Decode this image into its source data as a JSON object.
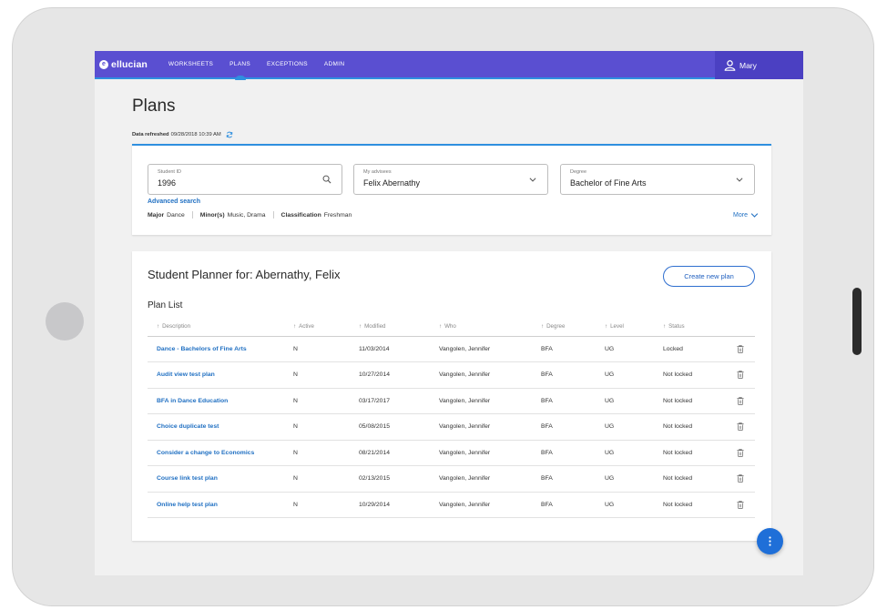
{
  "nav": {
    "logo": "ellucian",
    "items": [
      {
        "label": "WORKSHEETS",
        "active": false
      },
      {
        "label": "PLANS",
        "active": true
      },
      {
        "label": "EXCEPTIONS",
        "active": false
      },
      {
        "label": "ADMIN",
        "active": false
      }
    ],
    "user_name": "Mary",
    "user_icon": "user-icon"
  },
  "page": {
    "title": "Plans",
    "refreshed_label": "Data refreshed",
    "refreshed_value": "09/28/2018 10:39 AM",
    "refresh_icon": "refresh-icon"
  },
  "filters": {
    "student_id": {
      "label": "Student ID",
      "value": "1996",
      "icon": "search-icon"
    },
    "advisees": {
      "label": "My advisees",
      "value": "Felix Abernathy",
      "icon": "chevron-down-icon"
    },
    "degree": {
      "label": "Degree",
      "value": "Bachelor of Fine Arts",
      "icon": "chevron-down-icon"
    },
    "advanced_search": "Advanced search",
    "info": {
      "major_label": "Major",
      "major_value": "Dance",
      "minor_label": "Minor(s)",
      "minor_value": "Music, Drama",
      "class_label": "Classification",
      "class_value": "Freshman"
    },
    "more": "More"
  },
  "planner": {
    "title": "Student Planner for: Abernathy, Felix",
    "create_button": "Create new plan",
    "list_title": "Plan List",
    "columns": [
      "Description",
      "Active",
      "Modified",
      "Who",
      "Degree",
      "Level",
      "Status"
    ],
    "rows": [
      {
        "description": "Dance - Bachelors of Fine Arts",
        "active": "N",
        "modified": "11/03/2014",
        "who": "Vangolen, Jennifer",
        "degree": "BFA",
        "level": "UG",
        "status": "Locked"
      },
      {
        "description": "Audit view test plan",
        "active": "N",
        "modified": "10/27/2014",
        "who": "Vangolen, Jennifer",
        "degree": "BFA",
        "level": "UG",
        "status": "Not locked"
      },
      {
        "description": "BFA in Dance Education",
        "active": "N",
        "modified": "03/17/2017",
        "who": "Vangolen, Jennifer",
        "degree": "BFA",
        "level": "UG",
        "status": "Not locked"
      },
      {
        "description": "Choice duplicate test",
        "active": "N",
        "modified": "05/08/2015",
        "who": "Vangolen, Jennifer",
        "degree": "BFA",
        "level": "UG",
        "status": "Not locked"
      },
      {
        "description": "Consider a change to Economics",
        "active": "N",
        "modified": "08/21/2014",
        "who": "Vangolen, Jennifer",
        "degree": "BFA",
        "level": "UG",
        "status": "Not locked"
      },
      {
        "description": "Course link test plan",
        "active": "N",
        "modified": "02/13/2015",
        "who": "Vangolen, Jennifer",
        "degree": "BFA",
        "level": "UG",
        "status": "Not locked"
      },
      {
        "description": "Online help test plan",
        "active": "N",
        "modified": "10/29/2014",
        "who": "Vangolen, Jennifer",
        "degree": "BFA",
        "level": "UG",
        "status": "Not locked"
      }
    ],
    "row_action_icon": "trash-icon"
  },
  "fab_icon": "more-vertical-icon",
  "colors": {
    "nav": "#5a4fd1",
    "accent": "#2f8fdf",
    "link": "#1f6fc2",
    "fab": "#1f6fd8"
  }
}
